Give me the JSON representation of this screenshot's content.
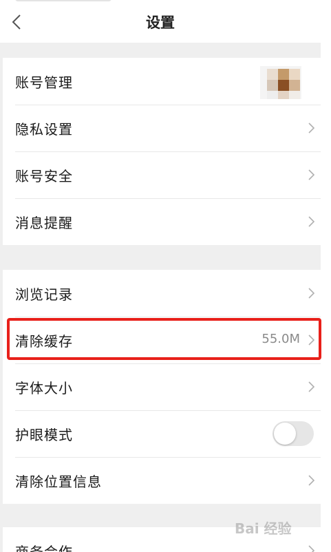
{
  "nav": {
    "title": "设置"
  },
  "groups": [
    {
      "items": [
        {
          "label": "账号管理",
          "accessory": "avatar"
        },
        {
          "label": "隐私设置",
          "accessory": "chevron"
        },
        {
          "label": "账号安全",
          "accessory": "chevron"
        },
        {
          "label": "消息提醒",
          "accessory": "chevron"
        }
      ]
    },
    {
      "items": [
        {
          "label": "浏览记录",
          "accessory": "chevron"
        },
        {
          "label": "清除缓存",
          "accessory": "chevron",
          "value": "55.0M",
          "highlighted": true
        },
        {
          "label": "字体大小",
          "accessory": "chevron"
        },
        {
          "label": "护眼模式",
          "accessory": "toggle",
          "toggle_on": false
        },
        {
          "label": "清除位置信息",
          "accessory": "chevron"
        }
      ]
    },
    {
      "items": [
        {
          "label": "商务合作",
          "accessory": "chevron"
        }
      ]
    }
  ],
  "colors": {
    "highlight_border": "#e8201a",
    "background": "#efefef"
  },
  "watermark": {
    "text": "Bai 经验"
  }
}
